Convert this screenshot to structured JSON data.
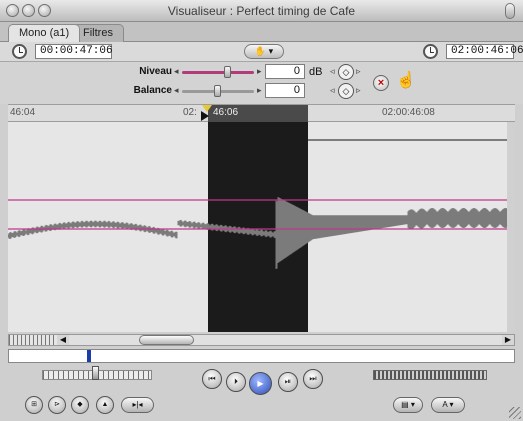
{
  "window": {
    "title": "Visualiseur : Perfect timing de Cafe"
  },
  "tabs": [
    {
      "label": "Mono (a1)"
    },
    {
      "label": "Filtres"
    }
  ],
  "toolbar": {
    "current_timecode": "00:00:47:06",
    "duration_timecode": "02:00:46:06"
  },
  "controls": {
    "level": {
      "label": "Niveau",
      "value": "0",
      "unit": "dB",
      "slider_level": 0.5
    },
    "pan": {
      "label": "Balance",
      "value": "0",
      "slider_level": 0.5
    }
  },
  "ruler": {
    "left_label": "46:04",
    "mid_label": "02:",
    "in_label": "46:06",
    "right_label": "02:00:46:08"
  },
  "colors": {
    "level_line": "#c0388c",
    "waveform": "#7b7b7b",
    "selection": "#1b1b1b",
    "accent": "#2d4fb6"
  },
  "icons": {
    "timecode": "clock-icon",
    "reset": "x-icon",
    "cursor": "hand-pointer-icon",
    "transport": [
      "previous-edit-icon",
      "play-in-to-out-icon",
      "play-icon",
      "play-around-icon",
      "next-edit-icon"
    ],
    "edit": [
      "mark-in-icon",
      "mark-out-icon",
      "add-keyframe-icon",
      "add-marker-icon",
      "match-frame-icon"
    ]
  }
}
